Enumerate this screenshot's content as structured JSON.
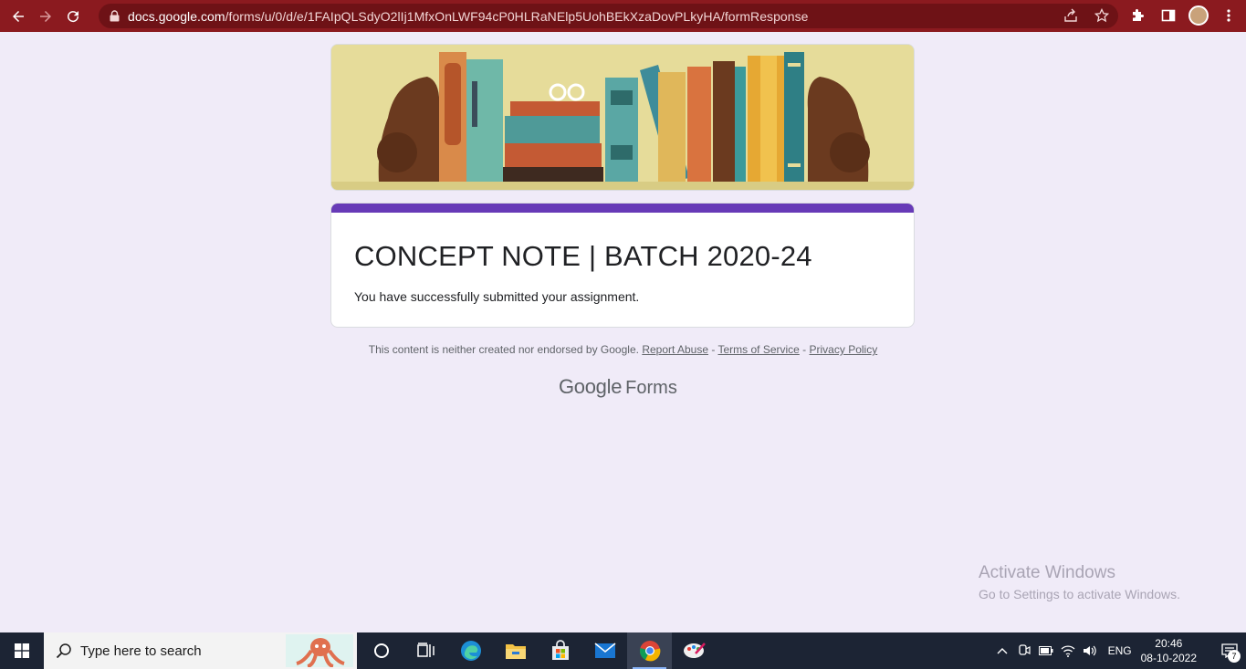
{
  "browser": {
    "url_host": "docs.google.com",
    "url_path": "/forms/u/0/d/e/1FAIpQLSdyO2lIj1MfxOnLWF94cP0HLRaNElp5UohBEkXzaDovPLkyHA/formResponse"
  },
  "form": {
    "title": "CONCEPT NOTE | BATCH 2020-24",
    "confirmation": "You have successfully submitted your assignment.",
    "accent_color": "#673ab7",
    "background_color": "#f0ebf8"
  },
  "footer": {
    "disclaimer": "This content is neither created nor endorsed by Google.",
    "report_abuse": "Report Abuse",
    "sep1": " - ",
    "terms": "Terms of Service",
    "sep2": " - ",
    "privacy": "Privacy Policy",
    "brand_google": "Google",
    "brand_forms": "Forms"
  },
  "watermark": {
    "line1": "Activate Windows",
    "line2": "Go to Settings to activate Windows."
  },
  "taskbar": {
    "search_placeholder": "Type here to search",
    "language": "ENG",
    "time": "20:46",
    "date": "08-10-2022",
    "notification_count": "7",
    "pinned": [
      "cortana-icon",
      "task-view-icon",
      "edge-icon",
      "file-explorer-icon",
      "store-icon",
      "mail-icon",
      "chrome-icon",
      "paint-icon"
    ]
  }
}
